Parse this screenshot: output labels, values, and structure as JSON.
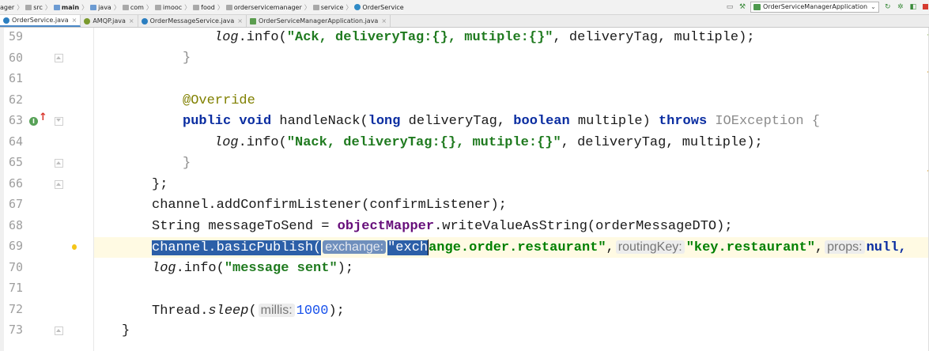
{
  "breadcrumb": [
    "ager",
    "src",
    "main",
    "java",
    "com",
    "imooc",
    "food",
    "orderservicemanager",
    "service",
    "OrderService"
  ],
  "run_config": {
    "label": "OrderServiceManagerApplication"
  },
  "tabs": [
    {
      "label": "OrderService.java",
      "active": true
    },
    {
      "label": "AMQP.java",
      "active": false
    },
    {
      "label": "OrderMessageService.java",
      "active": false
    },
    {
      "label": "OrderServiceManagerApplication.java",
      "active": false
    }
  ],
  "line_numbers": [
    "59",
    "60",
    "61",
    "62",
    "63",
    "64",
    "65",
    "66",
    "67",
    "68",
    "69",
    "70",
    "71",
    "72",
    "73"
  ],
  "code": {
    "l59": {
      "log": "log",
      "rest": ".info(",
      "str": "\"Ack, deliveryTag:{}, mutiple:{}\"",
      "tail": ", deliveryTag, multiple);"
    },
    "l60": {
      "text": "}"
    },
    "l62": {
      "text": "@Override"
    },
    "l63": {
      "public": "public",
      "void": "void",
      "name": " handleNack(",
      "long": "long",
      "p1": " deliveryTag, ",
      "boolean": "boolean",
      "p2": " multiple) ",
      "throws": "throws",
      "exc": " IOException",
      "brace": " {"
    },
    "l64": {
      "log": "log",
      "rest": ".info(",
      "str": "\"Nack, deliveryTag:{}, mutiple:{}\"",
      "tail": ", deliveryTag, multiple);"
    },
    "l65": {
      "text": "}"
    },
    "l66": {
      "text": "};"
    },
    "l67": {
      "text": "channel.addConfirmListener(confirmListener);"
    },
    "l68": {
      "a": "String messageToSend = ",
      "field": "objectMapper",
      "b": ".writeValueAsString(orderMessageDTO);"
    },
    "l69": {
      "sel_a": "channel.basicPublish(",
      "hint1": "exchange:",
      "sel_str": "\"exch",
      "rest_str": "ange.order.restaurant\"",
      "comma1": ",",
      "hint2": "routingKey:",
      "str2": "\"key.restaurant\"",
      "comma2": ",",
      "hint3": "props:",
      "null": "null,"
    },
    "l70": {
      "log": "log",
      "rest": ".info(",
      "str": "\"message sent\"",
      "tail": ");"
    },
    "l72": {
      "a": "Thread.",
      "sleep": "sleep",
      "b": "(",
      "hint": "millis:",
      "num": "1000",
      "c": ");"
    },
    "l73": {
      "text": "}"
    }
  }
}
